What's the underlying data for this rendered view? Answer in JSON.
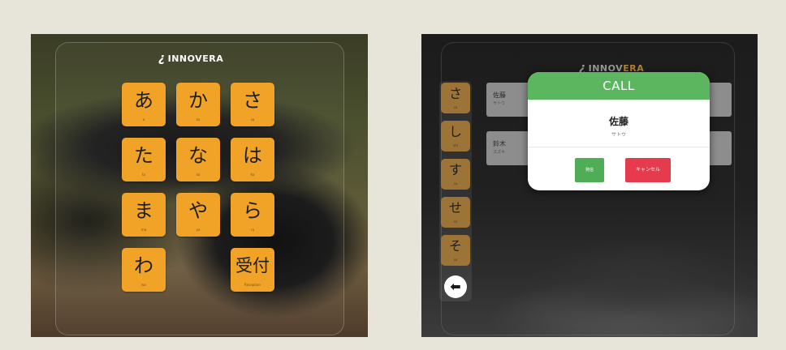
{
  "left_screen": {
    "logo": {
      "mark": "¿",
      "name_a": "INNOV",
      "name_b": "ERA"
    },
    "kana_buttons": [
      {
        "kana": "あ",
        "roma": "a"
      },
      {
        "kana": "か",
        "roma": "ka"
      },
      {
        "kana": "さ",
        "roma": "sa"
      },
      {
        "kana": "た",
        "roma": "ta"
      },
      {
        "kana": "な",
        "roma": "na"
      },
      {
        "kana": "は",
        "roma": "ha"
      },
      {
        "kana": "ま",
        "roma": "ma"
      },
      {
        "kana": "や",
        "roma": "ya"
      },
      {
        "kana": "ら",
        "roma": "ra"
      },
      {
        "kana": "わ",
        "roma": "wa"
      },
      {
        "kana": "受付",
        "roma": "Reception"
      }
    ],
    "colors": {
      "button": "#f0a327"
    }
  },
  "right_screen": {
    "logo": {
      "mark": "¿",
      "name_a": "INNOV",
      "name_b": "ERA"
    },
    "side_buttons": [
      {
        "kana": "さ",
        "roma": "sa"
      },
      {
        "kana": "し",
        "roma": "shi"
      },
      {
        "kana": "す",
        "roma": "su"
      },
      {
        "kana": "せ",
        "roma": "se"
      },
      {
        "kana": "そ",
        "roma": "so"
      }
    ],
    "back_icon": "arrow-left-icon",
    "list": [
      {
        "name": "佐藤",
        "reading": "サトウ"
      },
      {
        "name": "鈴木",
        "reading": "スズキ"
      }
    ],
    "modal": {
      "title": "CALL",
      "name": "佐藤",
      "reading": "サトウ",
      "call_label": "発信",
      "cancel_label": "キャンセル"
    },
    "colors": {
      "modal_header": "#5cb660",
      "call_button": "#4fae55",
      "cancel_button": "#e63b4c",
      "side_button": "#9c7438"
    }
  }
}
